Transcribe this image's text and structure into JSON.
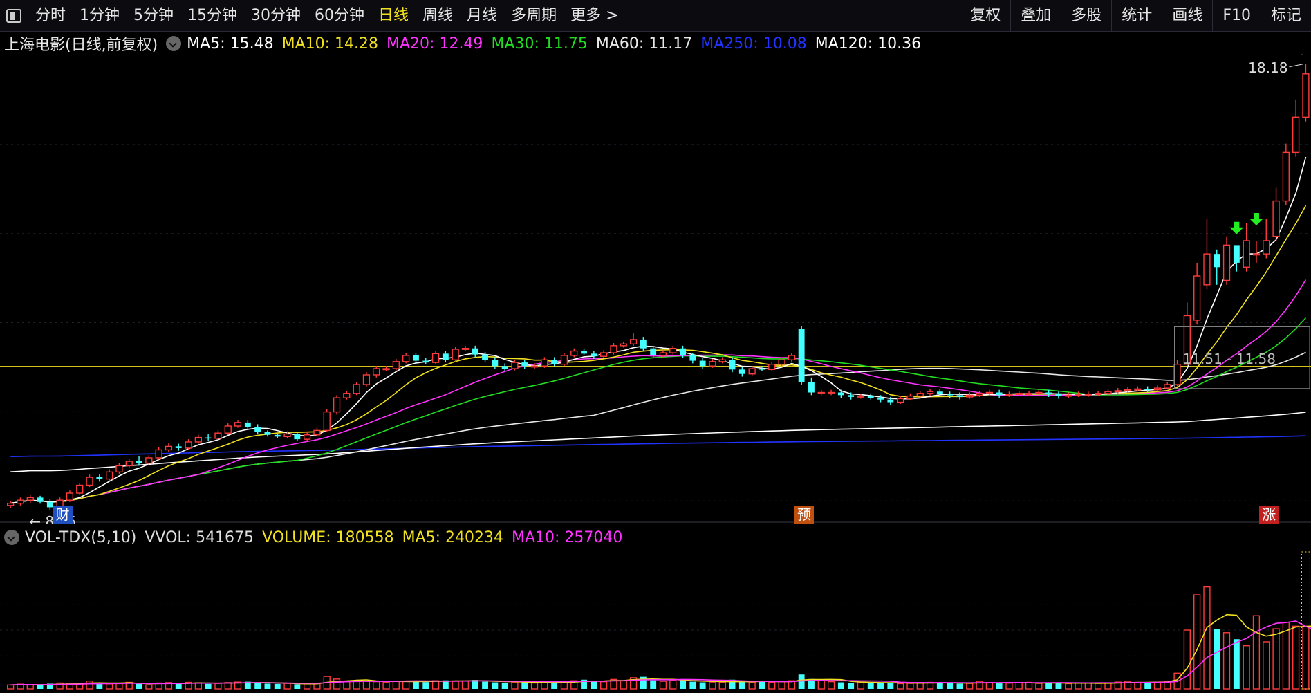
{
  "toolbar": {
    "periods": [
      "分时",
      "1分钟",
      "5分钟",
      "15分钟",
      "30分钟",
      "60分钟",
      "日线",
      "周线",
      "月线",
      "多周期",
      "更多 >"
    ],
    "active_period": "日线",
    "right_buttons": [
      "复权",
      "叠加",
      "多股",
      "统计",
      "画线",
      "F10",
      "标记"
    ]
  },
  "main_legend": {
    "title": "上海电影(日线,前复权)",
    "items": [
      {
        "label": "MA5: 15.48",
        "color": "#ffffff"
      },
      {
        "label": "MA10: 14.28",
        "color": "#f0e020"
      },
      {
        "label": "MA20: 12.49",
        "color": "#ff33ff"
      },
      {
        "label": "MA30: 11.75",
        "color": "#22dd22"
      },
      {
        "label": "MA60: 11.17",
        "color": "#e8e8e8"
      },
      {
        "label": "MA250: 10.08",
        "color": "#2233ff"
      },
      {
        "label": "MA120: 10.36",
        "color": "#ffffff"
      }
    ]
  },
  "vol_legend": {
    "items": [
      {
        "label": "VOL-TDX(5,10)",
        "color": "#e0e0e0"
      },
      {
        "label": "VVOL: 541675",
        "color": "#e0e0e0"
      },
      {
        "label": "VOLUME: 180558",
        "color": "#f0e020"
      },
      {
        "label": "MA5: 240234",
        "color": "#f0e020"
      },
      {
        "label": "MA10: 257040",
        "color": "#ff33ff"
      }
    ]
  },
  "annotations": {
    "high_label": "18.18",
    "low_label": "8.36",
    "range_label": "11.51 - 11.58",
    "badges": [
      {
        "text": "财",
        "color": "#2050c0",
        "index": 5
      },
      {
        "text": "预",
        "color": "#c05010",
        "index": 80
      },
      {
        "text": "涨",
        "color": "#c02020",
        "index": 127
      }
    ]
  },
  "chart_data": {
    "type": "candlestick",
    "title": "上海电影(日线,前复权)",
    "price_range": [
      8.1,
      18.6
    ],
    "reference_price": 11.55,
    "colors": {
      "up": "#ff3b3b",
      "down": "#44ffff",
      "ma5": "#ffffff",
      "ma10": "#f0e020",
      "ma20": "#ff33ff",
      "ma30": "#22dd22",
      "ma60": "#e8e8e8",
      "ma120": "#ffffff",
      "ma250": "#2233ff"
    },
    "close": [
      8.45,
      8.52,
      8.58,
      8.48,
      8.36,
      8.52,
      8.68,
      8.86,
      9.04,
      9.0,
      9.16,
      9.3,
      9.4,
      9.36,
      9.48,
      9.66,
      9.74,
      9.7,
      9.84,
      9.94,
      9.92,
      10.04,
      10.2,
      10.28,
      10.18,
      10.06,
      10.0,
      9.96,
      10.02,
      9.9,
      10.0,
      10.1,
      10.52,
      10.84,
      10.94,
      11.14,
      11.36,
      11.5,
      11.5,
      11.66,
      11.8,
      11.68,
      11.64,
      11.84,
      11.7,
      11.94,
      11.96,
      11.82,
      11.7,
      11.56,
      11.5,
      11.64,
      11.56,
      11.56,
      11.7,
      11.6,
      11.8,
      11.9,
      11.84,
      11.78,
      11.86,
      12.02,
      12.06,
      12.16,
      11.96,
      11.8,
      11.86,
      11.96,
      11.8,
      11.68,
      11.56,
      11.66,
      11.7,
      11.48,
      11.38,
      11.5,
      11.48,
      11.6,
      11.7,
      11.8,
      11.2,
      10.96,
      10.96,
      10.96,
      10.9,
      10.86,
      10.88,
      10.84,
      10.8,
      10.74,
      10.82,
      10.88,
      10.94,
      10.98,
      10.92,
      10.9,
      10.86,
      10.9,
      10.94,
      10.96,
      10.9,
      10.92,
      10.94,
      10.94,
      10.96,
      10.92,
      10.88,
      10.9,
      10.92,
      10.92,
      10.94,
      10.98,
      11.0,
      11.02,
      11.04,
      11.02,
      11.06,
      11.14,
      11.6,
      12.7,
      13.6,
      14.1,
      13.8,
      14.3,
      13.9,
      14.4,
      14.1,
      14.4,
      15.3,
      16.4,
      17.2,
      18.18
    ],
    "open": [
      8.4,
      8.45,
      8.52,
      8.58,
      8.48,
      8.36,
      8.52,
      8.68,
      8.86,
      9.04,
      9.0,
      9.16,
      9.3,
      9.4,
      9.36,
      9.48,
      9.66,
      9.74,
      9.7,
      9.84,
      9.94,
      9.92,
      10.04,
      10.2,
      10.28,
      10.18,
      10.06,
      10.0,
      9.96,
      10.02,
      9.9,
      10.0,
      10.1,
      10.52,
      10.84,
      10.94,
      11.14,
      11.36,
      11.5,
      11.5,
      11.66,
      11.8,
      11.68,
      11.64,
      11.84,
      11.7,
      11.94,
      11.96,
      11.82,
      11.7,
      11.56,
      11.5,
      11.64,
      11.56,
      11.56,
      11.7,
      11.6,
      11.8,
      11.9,
      11.84,
      11.78,
      11.86,
      12.02,
      12.06,
      12.16,
      11.96,
      11.8,
      11.86,
      11.96,
      11.8,
      11.68,
      11.56,
      11.66,
      11.7,
      11.48,
      11.38,
      11.5,
      11.48,
      11.6,
      11.7,
      12.4,
      11.2,
      10.96,
      10.96,
      10.96,
      10.9,
      10.86,
      10.88,
      10.84,
      10.8,
      10.74,
      10.82,
      10.88,
      10.94,
      10.98,
      10.92,
      10.9,
      10.86,
      10.9,
      10.94,
      10.96,
      10.9,
      10.92,
      10.94,
      10.94,
      10.96,
      10.92,
      10.88,
      10.9,
      10.92,
      10.92,
      10.94,
      10.98,
      11.0,
      11.02,
      11.04,
      11.02,
      11.06,
      11.14,
      11.6,
      12.6,
      13.4,
      14.1,
      13.5,
      14.3,
      13.8,
      14.1,
      14.1,
      14.5,
      15.3,
      16.4,
      17.2
    ],
    "high": [
      8.5,
      8.58,
      8.64,
      8.62,
      8.54,
      8.58,
      8.74,
      8.92,
      9.1,
      9.1,
      9.22,
      9.36,
      9.46,
      9.52,
      9.54,
      9.72,
      9.82,
      9.8,
      9.9,
      10.0,
      10.02,
      10.1,
      10.26,
      10.34,
      10.34,
      10.24,
      10.1,
      10.04,
      10.08,
      10.06,
      10.06,
      10.16,
      10.58,
      10.9,
      11.0,
      11.2,
      11.42,
      11.56,
      11.56,
      11.72,
      11.86,
      11.86,
      11.74,
      11.9,
      11.9,
      12.0,
      12.02,
      12.02,
      11.88,
      11.76,
      11.62,
      11.7,
      11.7,
      11.62,
      11.76,
      11.76,
      11.86,
      11.96,
      11.96,
      11.9,
      11.92,
      12.08,
      12.1,
      12.3,
      12.22,
      12.02,
      11.92,
      12.02,
      12.02,
      11.86,
      11.74,
      11.72,
      11.76,
      11.76,
      11.54,
      11.56,
      11.56,
      11.66,
      11.76,
      11.86,
      12.46,
      11.3,
      11.02,
      11.02,
      11.02,
      10.96,
      10.92,
      10.94,
      10.9,
      10.86,
      10.88,
      10.94,
      11.0,
      11.04,
      11.04,
      10.98,
      10.96,
      10.96,
      11.0,
      11.02,
      11.02,
      10.98,
      11.0,
      11.0,
      11.02,
      11.02,
      10.98,
      10.96,
      10.98,
      10.98,
      11.0,
      11.04,
      11.06,
      11.08,
      11.1,
      11.1,
      11.12,
      11.2,
      11.7,
      13.0,
      13.9,
      14.9,
      14.2,
      14.5,
      14.2,
      14.8,
      14.4,
      14.9,
      15.6,
      16.6,
      17.6,
      18.4
    ],
    "low": [
      8.34,
      8.4,
      8.46,
      8.44,
      8.3,
      8.32,
      8.48,
      8.64,
      8.82,
      8.94,
      8.96,
      9.12,
      9.26,
      9.3,
      9.32,
      9.44,
      9.62,
      9.64,
      9.66,
      9.8,
      9.86,
      9.88,
      10.0,
      10.16,
      10.12,
      10.02,
      9.96,
      9.92,
      9.92,
      9.86,
      9.86,
      9.96,
      10.06,
      10.46,
      10.8,
      10.9,
      11.1,
      11.3,
      11.44,
      11.46,
      11.62,
      11.62,
      11.6,
      11.6,
      11.64,
      11.66,
      11.9,
      11.76,
      11.64,
      11.5,
      11.44,
      11.46,
      11.5,
      11.5,
      11.52,
      11.56,
      11.56,
      11.76,
      11.8,
      11.72,
      11.74,
      11.82,
      11.98,
      12.02,
      11.9,
      11.74,
      11.76,
      11.82,
      11.74,
      11.62,
      11.5,
      11.52,
      11.62,
      11.42,
      11.32,
      11.34,
      11.44,
      11.44,
      11.56,
      11.66,
      11.14,
      10.9,
      10.9,
      10.9,
      10.84,
      10.8,
      10.82,
      10.8,
      10.74,
      10.68,
      10.7,
      10.78,
      10.84,
      10.88,
      10.86,
      10.84,
      10.8,
      10.82,
      10.86,
      10.88,
      10.84,
      10.86,
      10.88,
      10.88,
      10.9,
      10.86,
      10.82,
      10.84,
      10.86,
      10.86,
      10.88,
      10.9,
      10.94,
      10.96,
      10.98,
      10.96,
      11.0,
      11.04,
      11.1,
      11.56,
      12.5,
      13.3,
      13.4,
      13.4,
      13.7,
      13.7,
      13.9,
      14.0,
      14.4,
      15.2,
      16.3,
      17.1
    ],
    "volume_range": [
      0,
      900000
    ],
    "volume": [
      30000,
      36000,
      32000,
      28000,
      40000,
      45000,
      38000,
      42000,
      60000,
      45000,
      38000,
      40000,
      50000,
      38000,
      30000,
      45000,
      48000,
      42000,
      50000,
      46000,
      38000,
      42000,
      48000,
      52000,
      55000,
      45000,
      40000,
      38000,
      42000,
      35000,
      38000,
      40000,
      95000,
      75000,
      55000,
      62000,
      58000,
      55000,
      52000,
      58000,
      60000,
      56000,
      52000,
      62000,
      65000,
      58000,
      60000,
      68000,
      55000,
      50000,
      46000,
      52000,
      50000,
      45000,
      50000,
      48000,
      55000,
      62000,
      70000,
      58000,
      55000,
      72000,
      62000,
      85000,
      92000,
      65000,
      58000,
      62000,
      72000,
      55000,
      50000,
      48000,
      52000,
      70000,
      60000,
      52000,
      55000,
      50000,
      58000,
      62000,
      110000,
      75000,
      62000,
      55000,
      50000,
      46000,
      48000,
      52000,
      46000,
      44000,
      40000,
      42000,
      48000,
      50000,
      46000,
      44000,
      40000,
      42000,
      58000,
      48000,
      42000,
      44000,
      48000,
      50000,
      42000,
      44000,
      46000,
      40000,
      44000,
      46000,
      42000,
      44000,
      52000,
      58000,
      50000,
      46000,
      52000,
      60000,
      120000,
      450000,
      720000,
      780000,
      460000,
      430000,
      380000,
      330000,
      560000,
      360000,
      460000,
      510000,
      480000,
      480000,
      480000,
      470000,
      460000,
      360000
    ],
    "vol_ma5": [
      30000,
      33000,
      32700,
      31500,
      33200,
      36200,
      36600,
      38600,
      45000,
      46000,
      44600,
      44600,
      46600,
      42200,
      39200,
      40600,
      42200,
      41000,
      43000,
      46200,
      44800,
      43600,
      44800,
      45200,
      47000,
      48400,
      48000,
      46000,
      44000,
      40000,
      38600,
      38600,
      50000,
      56600,
      60600,
      65400,
      69000,
      61000,
      56400,
      57000,
      56600,
      56200,
      56600,
      57600,
      59000,
      60200,
      60400,
      62600,
      61200,
      58200,
      56000,
      56200,
      52400,
      48600,
      48600,
      49000,
      49600,
      52000,
      57000,
      58600,
      60000,
      63400,
      63400,
      70400,
      73200,
      75200,
      72400,
      72600,
      68000,
      62400,
      59400,
      57400,
      55400,
      55000,
      56000,
      54400,
      57800,
      57400,
      55000,
      55400,
      67000,
      71000,
      71400,
      72000,
      70400,
      57600,
      52200,
      50200,
      48400,
      47200,
      46000,
      44800,
      44000,
      44800,
      46000,
      46400,
      45600,
      44400,
      46000,
      46400,
      46000,
      47200,
      48000,
      46400,
      45200,
      44800,
      45200,
      44400,
      44000,
      44000,
      43600,
      43200,
      45600,
      48000,
      49200,
      50000,
      51600,
      53200,
      69600,
      157600,
      301800,
      470000,
      526000,
      568000,
      564000,
      474000,
      432000,
      404000,
      418000,
      444000,
      474000,
      478000,
      482000,
      480000,
      476000,
      460000
    ],
    "vol_ma10": [
      30000,
      33000,
      32700,
      31500,
      33200,
      34600,
      35100,
      35800,
      38400,
      39100,
      40900,
      41300,
      43100,
      42200,
      40700,
      40700,
      40900,
      41100,
      42800,
      43900,
      43900,
      43900,
      44700,
      46100,
      47100,
      47100,
      46400,
      45200,
      44400,
      43300,
      43300,
      43100,
      47400,
      51300,
      54800,
      56700,
      58400,
      57900,
      57200,
      57800,
      60000,
      61400,
      61000,
      59900,
      59300,
      59100,
      59800,
      61500,
      61600,
      60800,
      58500,
      58200,
      57500,
      57300,
      56500,
      55500,
      55400,
      56500,
      57800,
      58100,
      58900,
      60900,
      62100,
      65600,
      68800,
      69800,
      69900,
      70000,
      71900,
      71500,
      69700,
      67200,
      66300,
      64800,
      61300,
      58600,
      58300,
      56700,
      55500,
      56000,
      61200,
      63200,
      64600,
      63100,
      62100,
      62700,
      61300,
      60900,
      59700,
      58100,
      51100,
      48800,
      48800,
      48400,
      48600,
      48400,
      47600,
      46600,
      47800,
      48200,
      48400,
      48600,
      48600,
      47600,
      47200,
      47200,
      48000,
      47800,
      46400,
      46000,
      46400,
      46400,
      46800,
      47800,
      48600,
      48800,
      49800,
      51200,
      56800,
      98300,
      166700,
      240300,
      281200,
      320100,
      356100,
      386400,
      438200,
      473800,
      501800,
      507100,
      519400,
      476900,
      452000,
      428500,
      458000,
      442000
    ]
  }
}
